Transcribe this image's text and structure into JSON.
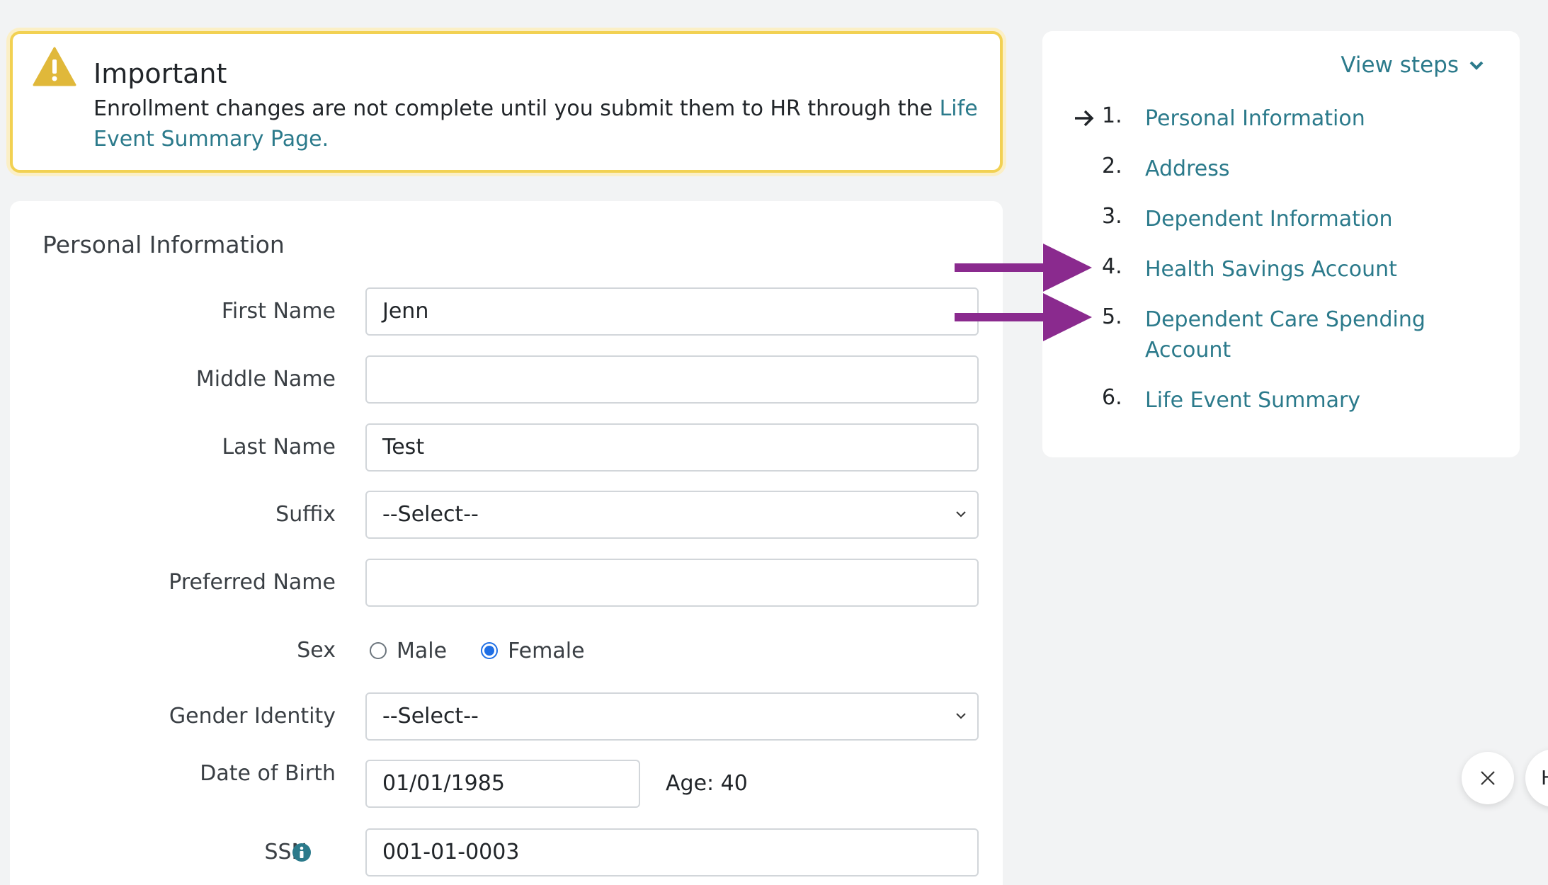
{
  "alert": {
    "title": "Important",
    "body_text": "Enrollment changes are not complete until you submit them to HR through the ",
    "link_text": "Life Event Summary Page."
  },
  "form": {
    "section_title": "Personal Information",
    "first_name": {
      "label": "First Name",
      "value": "Jenn"
    },
    "middle_name": {
      "label": "Middle Name",
      "value": ""
    },
    "last_name": {
      "label": "Last Name",
      "value": "Test"
    },
    "suffix": {
      "label": "Suffix",
      "value": "--Select--"
    },
    "preferred_name": {
      "label": "Preferred Name",
      "value": ""
    },
    "sex": {
      "label": "Sex",
      "options": [
        "Male",
        "Female"
      ],
      "selected": "Female"
    },
    "gender_identity": {
      "label": "Gender Identity",
      "value": "--Select--"
    },
    "dob": {
      "label": "Date of Birth",
      "value": "01/01/1985",
      "age_text": "Age: 40"
    },
    "ssn": {
      "label": "SSN",
      "value": "001-01-0003"
    }
  },
  "steps": {
    "toggle_label": "View steps",
    "items": [
      {
        "num": "1.",
        "label": "Personal Information"
      },
      {
        "num": "2.",
        "label": "Address"
      },
      {
        "num": "3.",
        "label": "Dependent Information"
      },
      {
        "num": "4.",
        "label": "Health Savings Account"
      },
      {
        "num": "5.",
        "label": "Dependent Care Spending Account"
      },
      {
        "num": "6.",
        "label": "Life Event Summary"
      }
    ]
  },
  "floating": {
    "partial_button_text": "H"
  },
  "colors": {
    "link": "#2b7a8b",
    "alert_border": "#f2d152",
    "warning_icon": "#e0b83a",
    "annotation_arrow": "#8a2a8e",
    "radio_checked": "#1f6fe5"
  },
  "icons": [
    "warning-icon",
    "chevron-down-icon",
    "arrow-right-icon",
    "info-icon",
    "close-icon"
  ]
}
